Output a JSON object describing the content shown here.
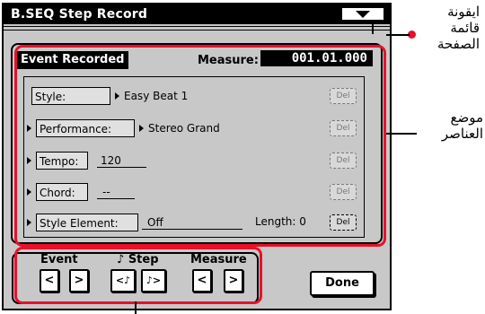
{
  "window": {
    "title": "B.SEQ Step Record"
  },
  "header": {
    "event_label": "Event Recorded",
    "measure_label": "Measure:",
    "measure_value": "001.01.000"
  },
  "rows": {
    "style": {
      "label": "Style:",
      "value": "Easy Beat 1"
    },
    "performance": {
      "label": "Performance:",
      "value": "Stereo Grand"
    },
    "tempo": {
      "label": "Tempo:",
      "value": "120"
    },
    "chord": {
      "label": "Chord:",
      "value": "--"
    },
    "style_element": {
      "label": "Style Element:",
      "value": "Off",
      "length_label": "Length: 0"
    }
  },
  "side_button_label": "Del",
  "nav": {
    "event_label": "Event",
    "step_label": "♪ Step",
    "measure_label": "Measure",
    "prev": "<",
    "next": ">",
    "step_prev": "<♪",
    "step_next": "♪>"
  },
  "done_label": "Done",
  "annotations": {
    "menu_callout": [
      "ايقونة",
      "قائمة",
      "الصفحة"
    ],
    "items_callout": [
      "موضع",
      "العناصر"
    ]
  },
  "colors": {
    "highlight": "#e8102a",
    "screen_bg": "#c8c8c8"
  }
}
